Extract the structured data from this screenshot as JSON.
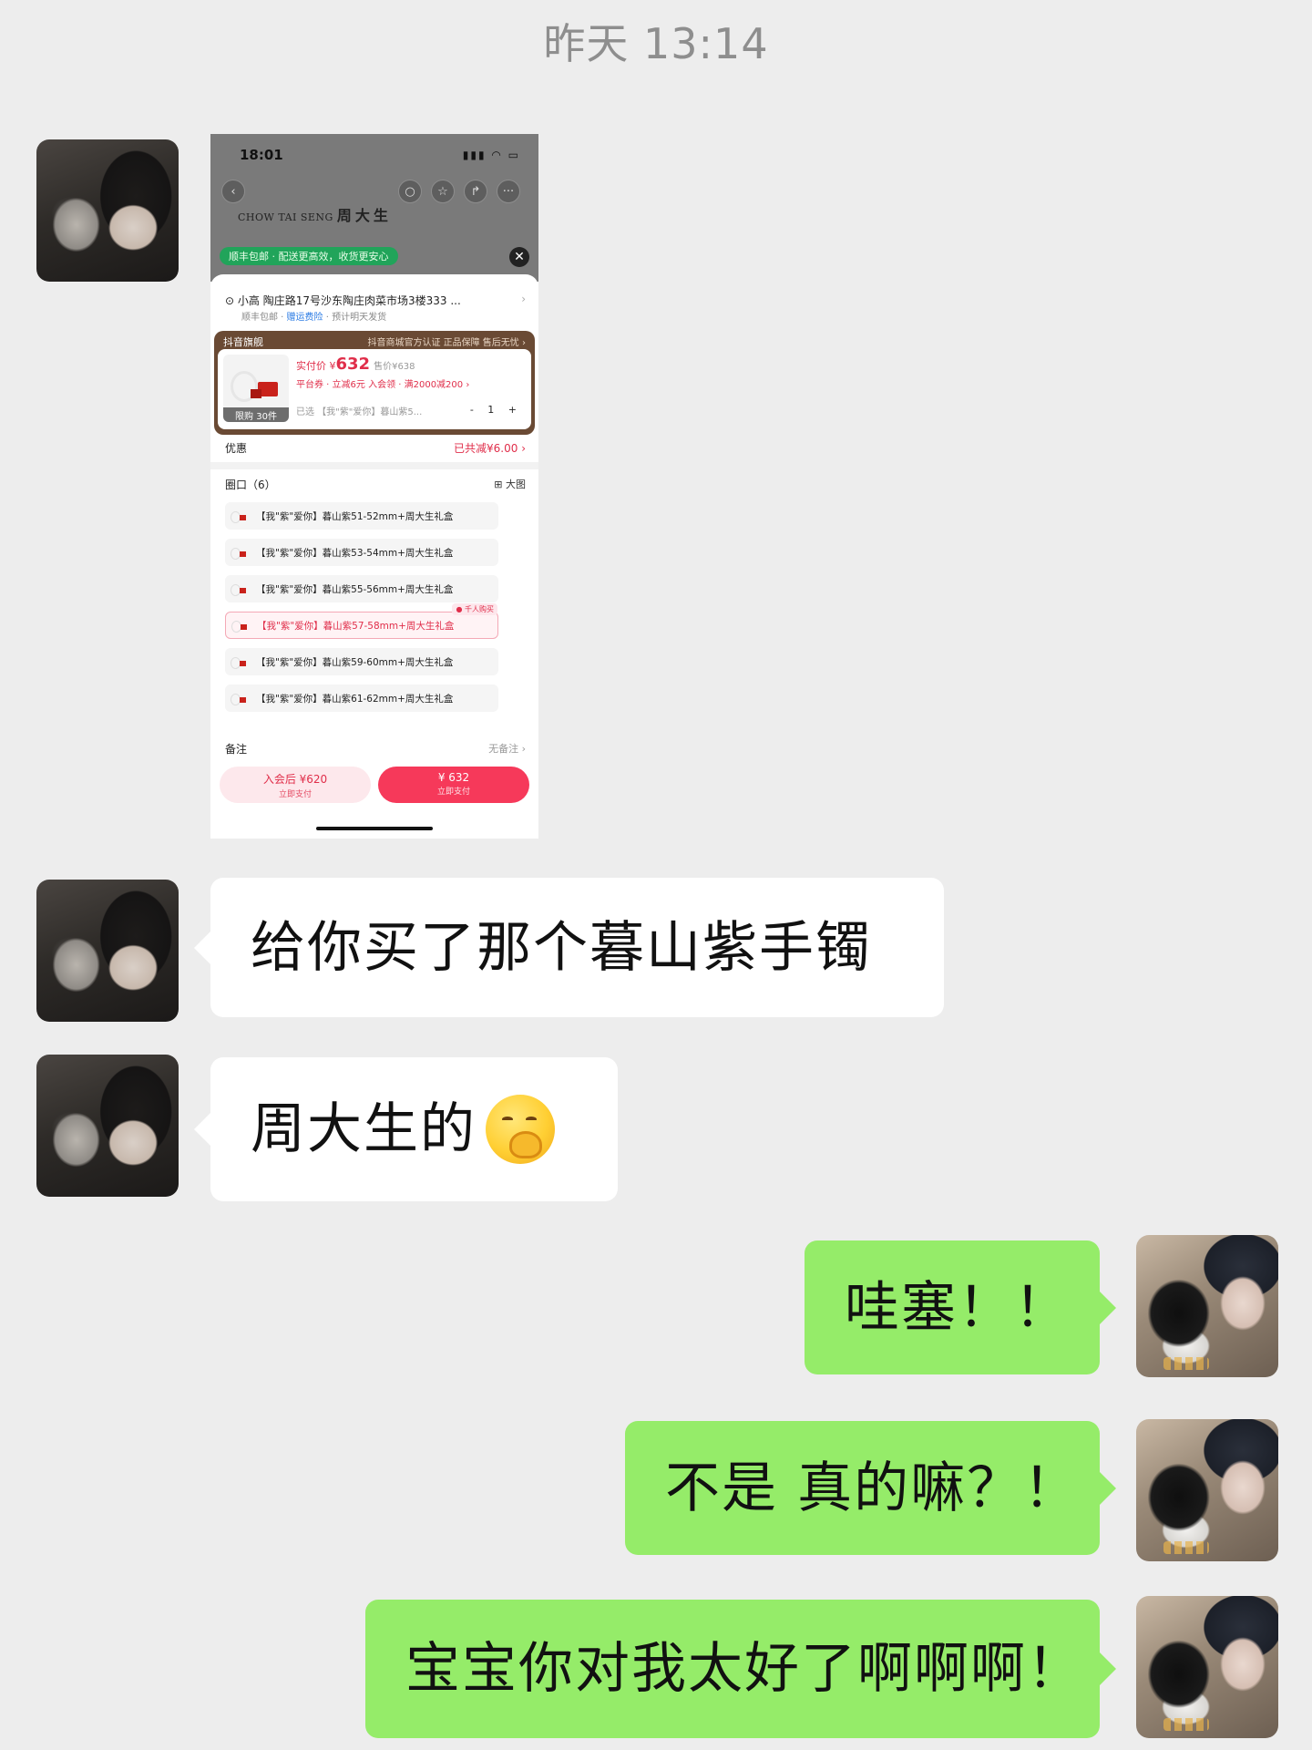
{
  "chat": {
    "timestamp": "昨天 13:14",
    "messages": [
      {
        "sender": "other",
        "text": "给你买了那个暮山紫手镯"
      },
      {
        "sender": "other",
        "text": "周大生的"
      },
      {
        "sender": "self",
        "text": "哇塞！！"
      },
      {
        "sender": "self",
        "text": "不是 真的嘛？！"
      },
      {
        "sender": "self",
        "text": "宝宝你对我太好了啊啊啊！"
      }
    ],
    "emoji": "thinking-hand-emoji"
  },
  "screenshot": {
    "status_time": "18:01",
    "status_icons": "▮▮▮ ◠ ▭",
    "brand_en": "CHOW TAI SENG",
    "brand_cn": "周大生",
    "shipping_banner": "顺丰包邮 · 配送更高效，收货更安心",
    "address": "小高 陶庄路17号沙东陶庄肉菜市场3楼333 ...",
    "address_sub_1": "顺丰包邮 · ",
    "address_sub_link": "赠运费险",
    "address_sub_2": " · 预计明天发货",
    "store_label": "抖音旗舰",
    "store_tags": "抖音商城官方认证   正品保障   售后无忧 ›",
    "price_label": "实付价 ¥",
    "price_value": "632",
    "price_original": "售价¥638",
    "promo": "平台券 · 立减6元    入会领 · 满2000减200 ›",
    "limit": "限购 30件",
    "selected": "已选 【我\"紫\"爱你】暮山紫5...",
    "quantity": "- 1 +",
    "discount_label": "优惠",
    "discount_value": "已共减¥6.00 ›",
    "size_label": "圈口（6）",
    "size_view": "⊞ 大图",
    "options": [
      "【我\"紫\"爱你】暮山紫51-52mm+周大生礼盒",
      "【我\"紫\"爱你】暮山紫53-54mm+周大生礼盒",
      "【我\"紫\"爱你】暮山紫55-56mm+周大生礼盒",
      "【我\"紫\"爱你】暮山紫57-58mm+周大生礼盒",
      "【我\"紫\"爱你】暮山紫59-60mm+周大生礼盒",
      "【我\"紫\"爱你】暮山紫61-62mm+周大生礼盒"
    ],
    "selected_option_tag": "● 千人购买",
    "note_label": "备注",
    "note_value": "无备注 ›",
    "member_button": "入会后 ¥620",
    "member_sub": "立即支付",
    "pay_button": "¥ 632",
    "pay_sub": "立即支付"
  },
  "colors": {
    "bg": "#ededed",
    "self_bubble": "#95ec69",
    "other_bubble": "#ffffff",
    "accent_red": "#e02e4a"
  }
}
